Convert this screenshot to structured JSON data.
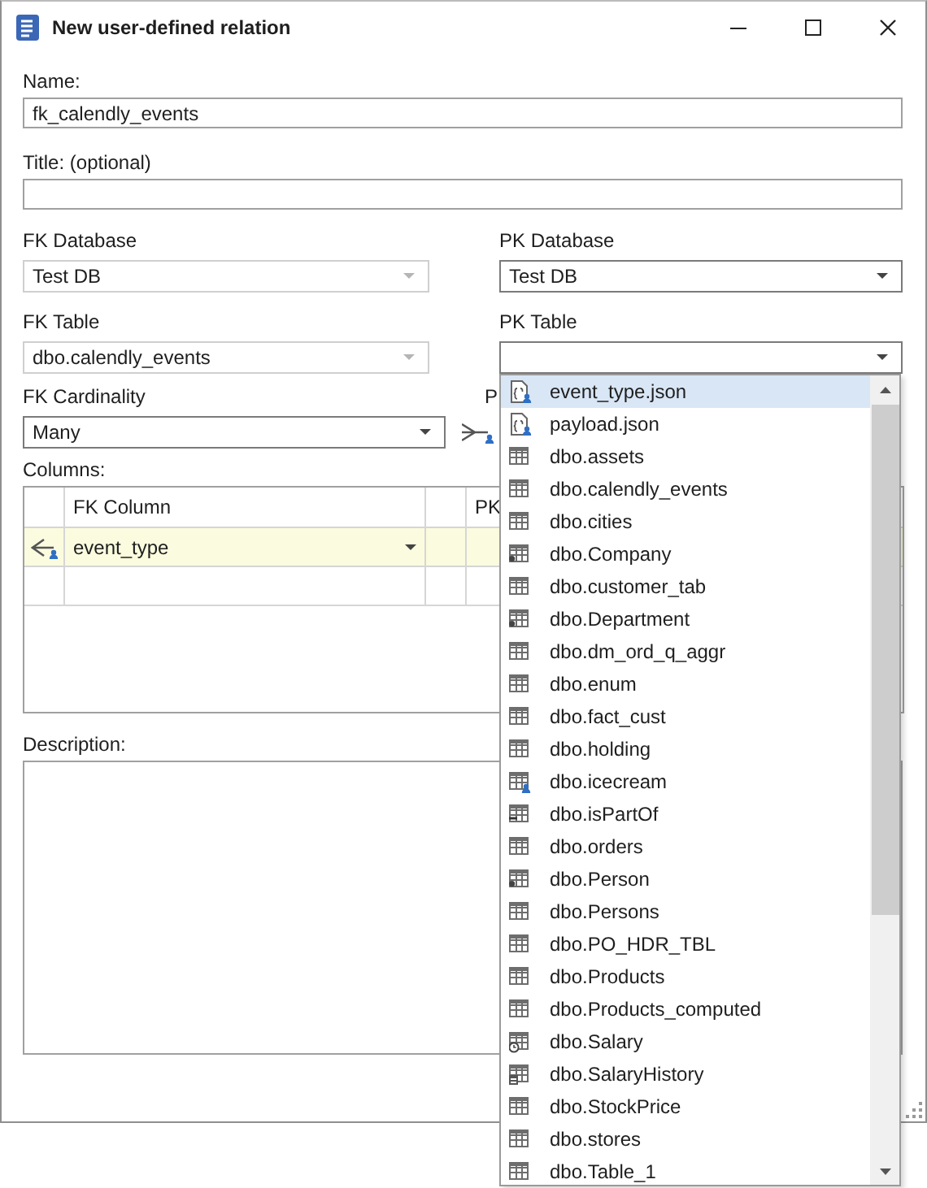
{
  "window": {
    "title": "New user-defined relation"
  },
  "name": {
    "label": "Name:",
    "value": "fk_calendly_events"
  },
  "title_field": {
    "label": "Title: (optional)"
  },
  "fk_database": {
    "label": "FK Database",
    "value": "Test DB",
    "disabled": true
  },
  "pk_database": {
    "label": "PK Database",
    "value": "Test DB",
    "disabled": false
  },
  "fk_table": {
    "label": "FK Table",
    "value": "dbo.calendly_events",
    "disabled": true
  },
  "pk_table": {
    "label": "PK Table",
    "disabled": false
  },
  "fk_cardinality": {
    "label": "FK Cardinality",
    "value": "Many",
    "disabled": false
  },
  "pk_cardinality": {
    "label": "P"
  },
  "columns": {
    "label": "Columns:",
    "headers": [
      {
        "kind": "fk",
        "label": "FK Column"
      },
      {
        "kind": "pk",
        "label": "PK"
      }
    ],
    "rows": [
      {
        "fk_column": "event_type",
        "selected": true
      }
    ]
  },
  "description": {
    "label": "Description:"
  },
  "pk_table_list": {
    "items": [
      {
        "label": "event_type.json",
        "kind": "json",
        "selected": true
      },
      {
        "label": "payload.json",
        "kind": "json",
        "selected": false
      },
      {
        "label": "dbo.assets",
        "kind": "table",
        "selected": false
      },
      {
        "label": "dbo.calendly_events",
        "kind": "table",
        "selected": false
      },
      {
        "label": "dbo.cities",
        "kind": "table",
        "selected": false
      },
      {
        "label": "dbo.Company",
        "kind": "table-dot",
        "selected": false
      },
      {
        "label": "dbo.customer_tab",
        "kind": "table",
        "selected": false
      },
      {
        "label": "dbo.Department",
        "kind": "table-dot",
        "selected": false
      },
      {
        "label": "dbo.dm_ord_q_aggr",
        "kind": "table",
        "selected": false
      },
      {
        "label": "dbo.enum",
        "kind": "table",
        "selected": false
      },
      {
        "label": "dbo.fact_cust",
        "kind": "table",
        "selected": false
      },
      {
        "label": "dbo.holding",
        "kind": "table",
        "selected": false
      },
      {
        "label": "dbo.icecream",
        "kind": "table-person",
        "selected": false
      },
      {
        "label": "dbo.isPartOf",
        "kind": "table-link",
        "selected": false
      },
      {
        "label": "dbo.orders",
        "kind": "table",
        "selected": false
      },
      {
        "label": "dbo.Person",
        "kind": "table-dot",
        "selected": false
      },
      {
        "label": "dbo.Persons",
        "kind": "table",
        "selected": false
      },
      {
        "label": "dbo.PO_HDR_TBL",
        "kind": "table",
        "selected": false
      },
      {
        "label": "dbo.Products",
        "kind": "table",
        "selected": false
      },
      {
        "label": "dbo.Products_computed",
        "kind": "table",
        "selected": false
      },
      {
        "label": "dbo.Salary",
        "kind": "table-clock",
        "selected": false
      },
      {
        "label": "dbo.SalaryHistory",
        "kind": "table-calc",
        "selected": false
      },
      {
        "label": "dbo.StockPrice",
        "kind": "table",
        "selected": false
      },
      {
        "label": "dbo.stores",
        "kind": "table",
        "selected": false
      },
      {
        "label": "dbo.Table_1",
        "kind": "table",
        "selected": false
      }
    ]
  }
}
